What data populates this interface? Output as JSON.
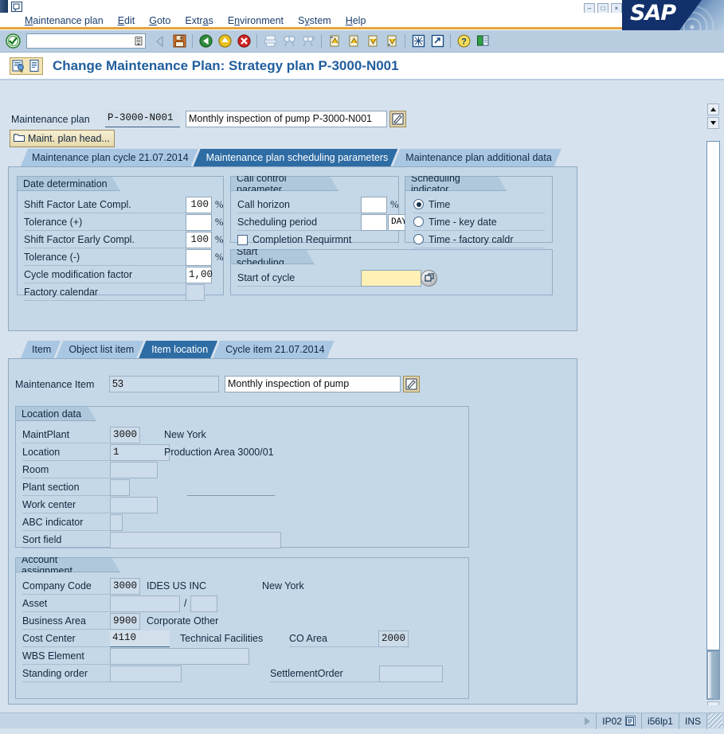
{
  "window": {
    "minimize_label": "–",
    "maximize_label": "□",
    "close_label": "×",
    "logo_text": "SAP"
  },
  "menubar": {
    "items": [
      {
        "label": "Maintenance plan"
      },
      {
        "label": "Edit"
      },
      {
        "label": "Goto"
      },
      {
        "label": "Extras"
      },
      {
        "label": "Environment"
      },
      {
        "label": "System"
      },
      {
        "label": "Help"
      }
    ]
  },
  "toolbar": {
    "command_field_value": "",
    "buttons": [
      {
        "name": "enter-check-icon"
      },
      {
        "name": "save-icon"
      },
      {
        "name": "back-icon"
      },
      {
        "name": "exit-icon"
      },
      {
        "name": "cancel-icon"
      },
      {
        "name": "print-icon"
      },
      {
        "name": "find-icon"
      },
      {
        "name": "find-next-icon"
      },
      {
        "name": "first-page-icon"
      },
      {
        "name": "previous-page-icon"
      },
      {
        "name": "next-page-icon"
      },
      {
        "name": "last-page-icon"
      },
      {
        "name": "scheduling-icon"
      },
      {
        "name": "call-object-icon"
      },
      {
        "name": "help-icon"
      },
      {
        "name": "layout-menu-icon"
      }
    ]
  },
  "screen": {
    "title": "Change Maintenance Plan: Strategy plan P-3000-N001"
  },
  "header": {
    "maintenance_plan_label": "Maintenance plan",
    "maintenance_plan_number": "P-3000-N001",
    "maintenance_plan_desc": "Monthly inspection of pump P-3000-N001",
    "head_button_label": "Maint. plan head..."
  },
  "plan_tabs": [
    {
      "label": "Maintenance plan cycle 21.07.2014",
      "active": false
    },
    {
      "label": "Maintenance plan scheduling parameters",
      "active": true
    },
    {
      "label": "Maintenance plan additional data",
      "active": false
    }
  ],
  "date_determination": {
    "title": "Date determination",
    "fields": [
      {
        "label": "Shift Factor Late Compl.",
        "value": "100",
        "unit": "%"
      },
      {
        "label": "Tolerance (+)",
        "value": "",
        "unit": "%"
      },
      {
        "label": "Shift Factor Early Compl.",
        "value": "100",
        "unit": "%"
      },
      {
        "label": "Tolerance (-)",
        "value": "",
        "unit": "%"
      },
      {
        "label": "Cycle modification factor",
        "value": "1,00",
        "unit": ""
      },
      {
        "label": "Factory calendar",
        "value": "",
        "unit": ""
      }
    ]
  },
  "call_control": {
    "title": "Call control parameter",
    "call_horizon_label": "Call horizon",
    "call_horizon_value": "",
    "call_horizon_unit": "%",
    "scheduling_period_label": "Scheduling period",
    "scheduling_period_value": "",
    "scheduling_period_unit": "DAY",
    "completion_req_label": "Completion Requirmnt",
    "completion_req_checked": false
  },
  "scheduling_indicator": {
    "title": "Scheduling indicator",
    "options": [
      {
        "label": "Time",
        "selected": true
      },
      {
        "label": "Time - key date",
        "selected": false
      },
      {
        "label": "Time - factory caldr",
        "selected": false
      }
    ]
  },
  "start_scheduling": {
    "title": "Start scheduling",
    "start_of_cycle_label": "Start of cycle",
    "start_of_cycle_value": ""
  },
  "item_tabs": [
    {
      "label": "Item",
      "active": false
    },
    {
      "label": "Object list item",
      "active": false
    },
    {
      "label": "Item location",
      "active": true
    },
    {
      "label": "Cycle item 21.07.2014",
      "active": false
    }
  ],
  "item_header": {
    "label": "Maintenance Item",
    "number": "53",
    "description": "Monthly inspection of pump"
  },
  "location_data": {
    "title": "Location data",
    "rows": [
      {
        "label": "MaintPlant",
        "value": "3000",
        "text": "New York"
      },
      {
        "label": "Location",
        "value": "1",
        "text": "Production Area 3000/01"
      },
      {
        "label": "Room",
        "value": "",
        "text": ""
      },
      {
        "label": "Plant section",
        "value": "",
        "text": ""
      },
      {
        "label": "Work center",
        "value": "",
        "text": ""
      },
      {
        "label": "ABC indicator",
        "value": "",
        "text": ""
      },
      {
        "label": "Sort field",
        "value": "",
        "text": ""
      }
    ]
  },
  "account_assignment": {
    "title": "Account assignment",
    "company_code_label": "Company Code",
    "company_code_value": "3000",
    "company_code_text": "IDES US INC",
    "company_code_city": "New York",
    "asset_label": "Asset",
    "asset_value": "",
    "asset_sub_value": "",
    "asset_separator": "/",
    "business_area_label": "Business Area",
    "business_area_value": "9900",
    "business_area_text": "Corporate Other",
    "cost_center_label": "Cost Center",
    "cost_center_value": "4110",
    "cost_center_text": "Technical Facilities",
    "co_area_label": "CO Area",
    "co_area_value": "2000",
    "wbs_element_label": "WBS Element",
    "wbs_element_value": "",
    "standing_order_label": "Standing order",
    "standing_order_value": "",
    "settlement_order_label": "SettlementOrder",
    "settlement_order_value": ""
  },
  "statusbar": {
    "transaction": "IP02",
    "system": "i56lp1",
    "insert_mode": "INS"
  }
}
